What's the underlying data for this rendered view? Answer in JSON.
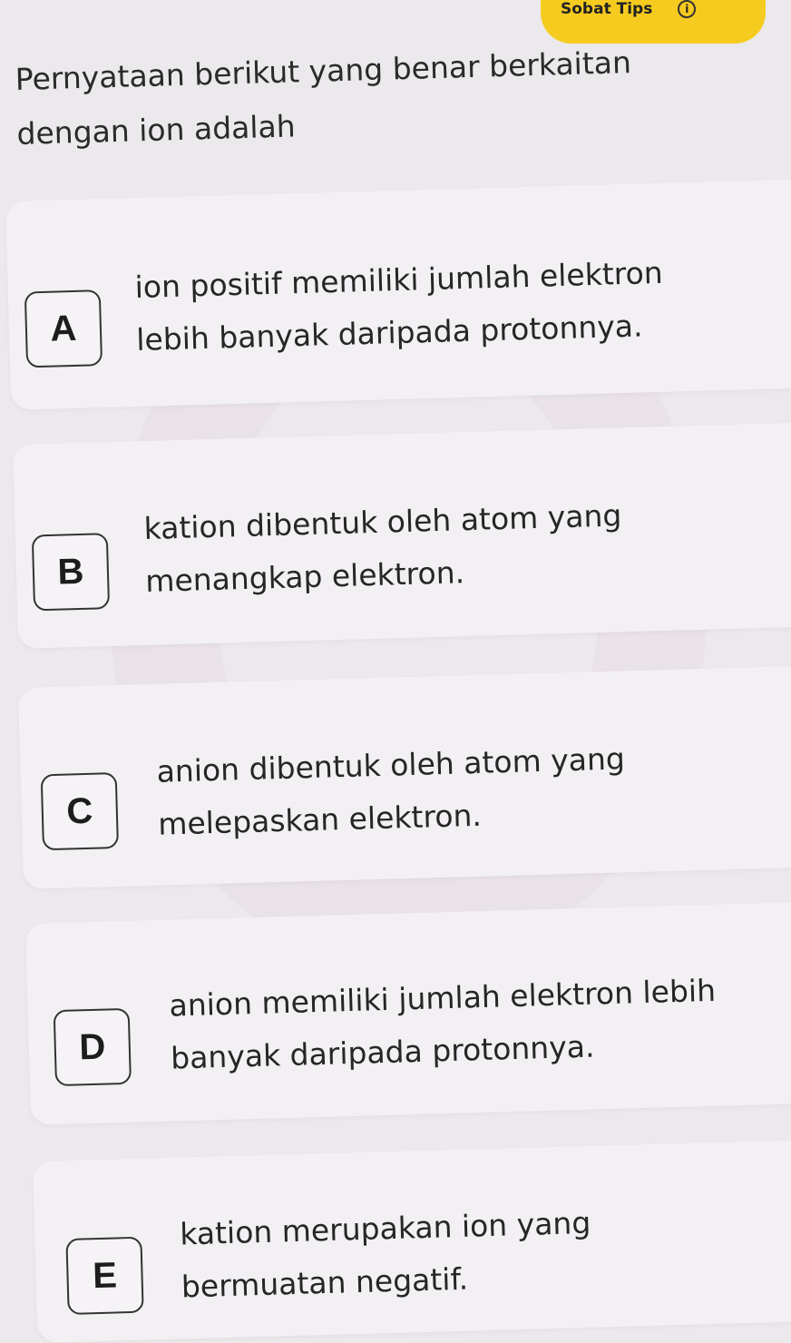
{
  "badge": {
    "label": "Sobat Tips",
    "icon": "info-icon",
    "icon_glyph": "i"
  },
  "question": {
    "line1": "Pernyataan berikut yang benar berkaitan",
    "line2": "dengan ion adalah"
  },
  "options": [
    {
      "letter": "A",
      "line1": "ion positif memiliki jumlah elektron",
      "line2": "lebih banyak daripada protonnya."
    },
    {
      "letter": "B",
      "line1": "kation dibentuk oleh atom yang",
      "line2": "menangkap elektron."
    },
    {
      "letter": "C",
      "line1": "anion dibentuk oleh atom yang",
      "line2": "melepaskan elektron."
    },
    {
      "letter": "D",
      "line1": "anion memiliki jumlah elektron lebih",
      "line2": "banyak daripada protonnya."
    },
    {
      "letter": "E",
      "line1": "kation merupakan ion yang",
      "line2": "bermuatan negatif."
    }
  ],
  "colors": {
    "background": "#ebe9ec",
    "card": "#f2f0f3",
    "badge": "#f6cb1f",
    "text": "#262626"
  }
}
